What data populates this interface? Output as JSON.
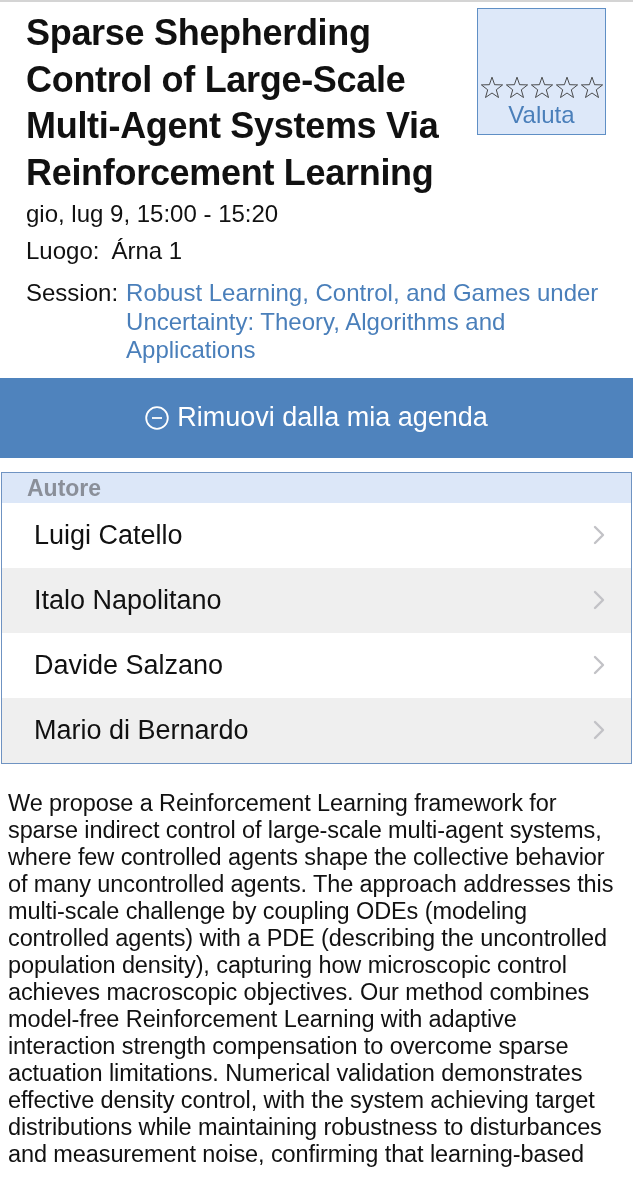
{
  "event": {
    "title": "Sparse Shepherding Control of Large-Scale Multi-Agent Systems Via Reinforcement Learning",
    "datetime": "gio, lug 9, 15:00 - 15:20",
    "location_label": "Luogo:",
    "location": "Árna 1",
    "session_label": "Session:",
    "session": "Robust Learning, Control, and Games under Uncertainty: Theory, Algorithms and Applications"
  },
  "rating": {
    "stars": 0,
    "label": "Valuta"
  },
  "agenda_button": {
    "label": "Rimuovi dalla mia agenda"
  },
  "authors": {
    "header": "Autore",
    "items": [
      {
        "name": "Luigi Catello"
      },
      {
        "name": "Italo Napolitano"
      },
      {
        "name": "Davide Salzano"
      },
      {
        "name": "Mario di Bernardo"
      }
    ]
  },
  "abstract": "We propose a Reinforcement Learning framework for sparse indirect control of large-scale multi-agent systems, where few controlled agents shape the collective behavior of many uncontrolled agents. The approach addresses this multi-scale challenge by coupling ODEs (modeling controlled agents) with a PDE (describing the uncontrolled population density), capturing how microscopic control achieves macroscopic objectives. Our method combines model-free Reinforcement Learning with adaptive interaction strength compensation to overcome sparse actuation limitations. Numerical validation demonstrates effective density control, with the system achieving target distributions while maintaining robustness to disturbances and measurement noise, confirming that learning-based"
}
